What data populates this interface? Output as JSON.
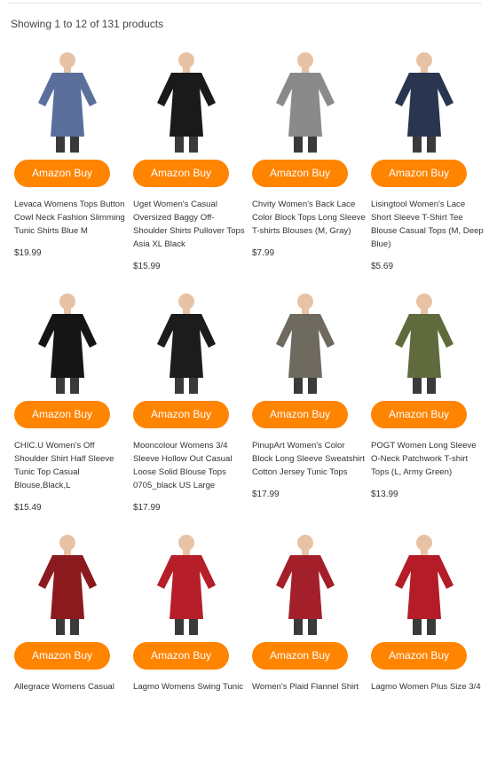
{
  "result_count": "Showing 1 to 12 of 131 products",
  "button_label": "Amazon Buy",
  "colors": {
    "button": "#ff8400"
  },
  "products": [
    {
      "title": "Levaca Womens Tops Button Cowl Neck Fashion Slimming Tunic Shirts Blue M",
      "price": "$19.99",
      "image": "blue-cowl-neck-tunic",
      "color": "#5a6f9c"
    },
    {
      "title": "Uget Women's Casual Oversized Baggy Off-Shoulder Shirts Pullover Tops Asia XL Black",
      "price": "$15.99",
      "image": "black-off-shoulder-pullover",
      "color": "#1a1a1a"
    },
    {
      "title": "Chvity Women's Back Lace Color Block Tops Long Sleeve T-shirts Blouses (M, Gray)",
      "price": "$7.99",
      "image": "gray-color-block-top",
      "color": "#8a8a8a"
    },
    {
      "title": "Lisingtool Women's Lace Short Sleeve T-Shirt Tee Blouse Casual Tops (M, Deep Blue)",
      "price": "$5.69",
      "image": "navy-lace-sleeve-tee",
      "color": "#2a3550"
    },
    {
      "title": "CHIC.U Women's Off Shoulder Shirt Half Sleeve Tunic Top Casual Blouse,Black,L",
      "price": "$15.49",
      "image": "black-cutout-sleeve-tunic",
      "color": "#151515"
    },
    {
      "title": "Mooncolour Womens 3/4 Sleeve Hollow Out Casual Loose Solid Blouse Tops 0705_black US Large",
      "price": "$17.99",
      "image": "black-lace-up-blouse",
      "color": "#1c1c1c"
    },
    {
      "title": "PinupArt Women's Color Block Long Sleeve Sweatshirt Cotton Jersey Tunic Tops",
      "price": "$17.99",
      "image": "striped-sleeve-tunic",
      "color": "#6f6a60"
    },
    {
      "title": "POGT Women Long Sleeve O-Neck Patchwork T-shirt Tops (L, Army Green)",
      "price": "$13.99",
      "image": "army-green-patchwork-top",
      "color": "#5f6b3c"
    },
    {
      "title": "Allegrace Womens Casual",
      "price": "",
      "image": "red-vneck-tunic",
      "color": "#8b1a1f"
    },
    {
      "title": "Lagmo Womens Swing Tunic",
      "price": "",
      "image": "red-swing-tunic",
      "color": "#b61e2a"
    },
    {
      "title": "Women's Plaid Flannel Shirt",
      "price": "",
      "image": "red-plaid-flannel-shirt",
      "color": "#a3202a"
    },
    {
      "title": "Lagmo Women Plus Size 3/4",
      "price": "",
      "image": "red-plus-size-tunic",
      "color": "#b41c28"
    }
  ]
}
